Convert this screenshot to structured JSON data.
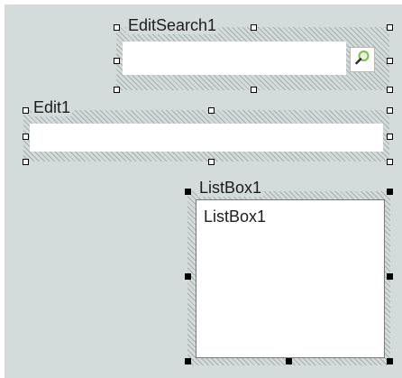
{
  "edit_search": {
    "caption": "EditSearch1",
    "value": "",
    "search_icon": "magnifier-icon"
  },
  "edit": {
    "caption": "Edit1",
    "value": ""
  },
  "listbox": {
    "caption": "ListBox1",
    "items": [
      "ListBox1"
    ]
  },
  "colors": {
    "form_background": "#d4dbdb",
    "hatch": "#a7aeae",
    "search_icon_accent": "#7ac043"
  }
}
